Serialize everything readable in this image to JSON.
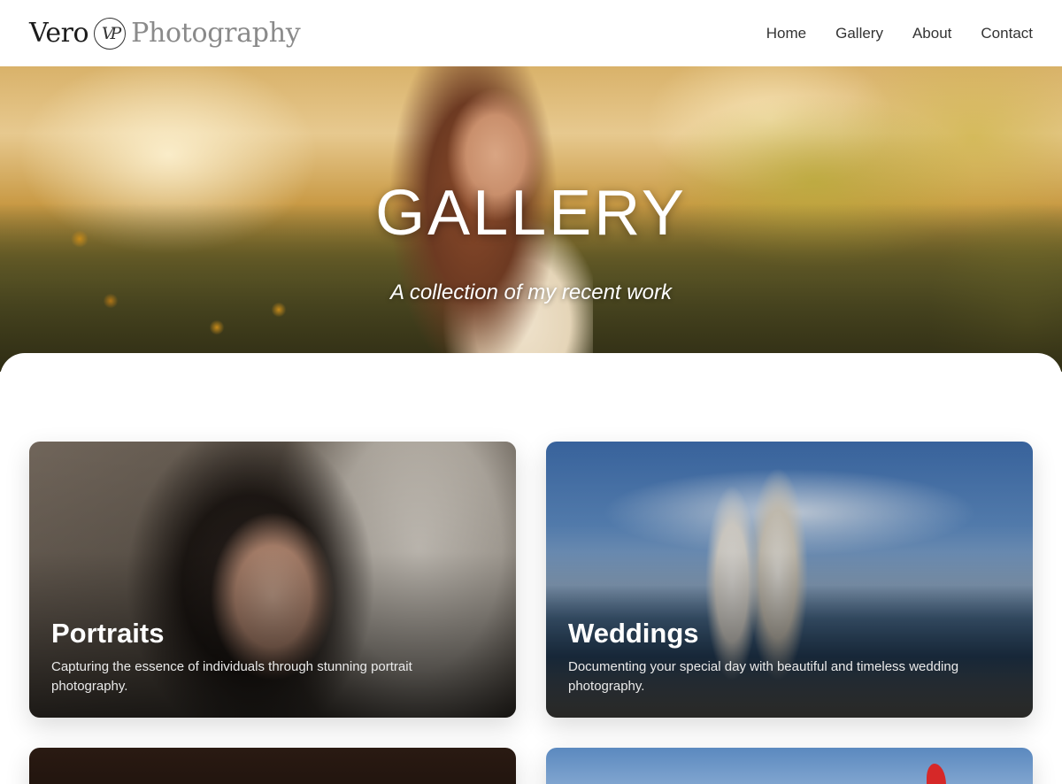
{
  "header": {
    "logo": {
      "word1": "Vero",
      "mark": "VP",
      "word2": "Photography"
    },
    "nav": [
      "Home",
      "Gallery",
      "About",
      "Contact"
    ]
  },
  "hero": {
    "title": "GALLERY",
    "subtitle": "A collection of my recent work"
  },
  "cards": [
    {
      "title": "Portraits",
      "description": "Capturing the essence of individuals through stunning portrait photography."
    },
    {
      "title": "Weddings",
      "description": "Documenting your special day with beautiful and timeless wedding photography."
    }
  ],
  "colors": {
    "accent_text": "#ffffff",
    "nav_text": "#333333",
    "logo_secondary": "#8a8a8a"
  }
}
